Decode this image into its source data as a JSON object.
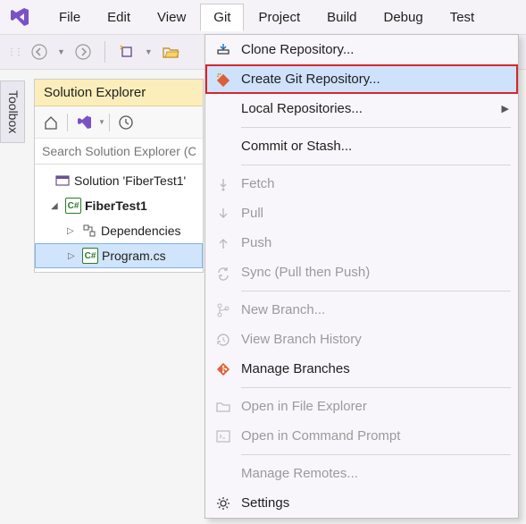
{
  "menubar": {
    "items": [
      "File",
      "Edit",
      "View",
      "Git",
      "Project",
      "Build",
      "Debug",
      "Test"
    ],
    "active_index": 3
  },
  "sidetab": {
    "label": "Toolbox"
  },
  "panel": {
    "title": "Solution Explorer",
    "search_placeholder": "Search Solution Explorer (Ctrl+;)",
    "tree": {
      "solution": "Solution 'FiberTest1'",
      "project": "FiberTest1",
      "dependencies": "Dependencies",
      "program": "Program.cs"
    }
  },
  "git_menu": {
    "clone": "Clone Repository...",
    "create": "Create Git Repository...",
    "local": "Local Repositories...",
    "commit": "Commit or Stash...",
    "fetch": "Fetch",
    "pull": "Pull",
    "push": "Push",
    "sync": "Sync (Pull then Push)",
    "new_branch": "New Branch...",
    "history": "View Branch History",
    "manage_branches": "Manage Branches",
    "explorer": "Open in File Explorer",
    "cmd": "Open in Command Prompt",
    "remotes": "Manage Remotes...",
    "settings": "Settings"
  }
}
